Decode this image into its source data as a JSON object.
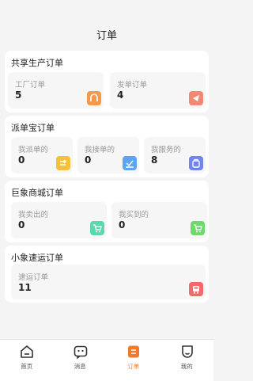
{
  "header": {
    "title": "订单"
  },
  "sections": [
    {
      "title": "共享生产订单",
      "cards": [
        {
          "label": "工厂订单",
          "value": "5",
          "icon": "factory-order-icon",
          "color": "#f39a4a"
        },
        {
          "label": "发单订单",
          "value": "4",
          "icon": "send-order-icon",
          "color": "#f58872"
        }
      ]
    },
    {
      "title": "派单宝订单",
      "cards": [
        {
          "label": "我派单的",
          "value": "0",
          "icon": "dispatch-icon",
          "color": "#f7c03a"
        },
        {
          "label": "我接单的",
          "value": "0",
          "icon": "accept-icon",
          "color": "#5aa6f5"
        },
        {
          "label": "我服务的",
          "value": "8",
          "icon": "service-icon",
          "color": "#6f86f2"
        }
      ]
    },
    {
      "title": "巨象商城订单",
      "cards": [
        {
          "label": "我卖出的",
          "value": "0",
          "icon": "sold-cart-icon",
          "color": "#5ad9b0"
        },
        {
          "label": "我买到的",
          "value": "0",
          "icon": "bought-cart-icon",
          "color": "#6fd86a"
        }
      ]
    },
    {
      "title": "小象速运订单",
      "cards": [
        {
          "label": "速运订单",
          "value": "11",
          "icon": "truck-icon",
          "color": "#f26a6a"
        }
      ]
    }
  ],
  "tabs": [
    {
      "label": "首页",
      "icon": "home-icon"
    },
    {
      "label": "消息",
      "icon": "message-icon"
    },
    {
      "label": "订单",
      "icon": "order-icon",
      "active": true
    },
    {
      "label": "我的",
      "icon": "profile-icon"
    }
  ],
  "colors": {
    "accent": "#f07a2a"
  }
}
